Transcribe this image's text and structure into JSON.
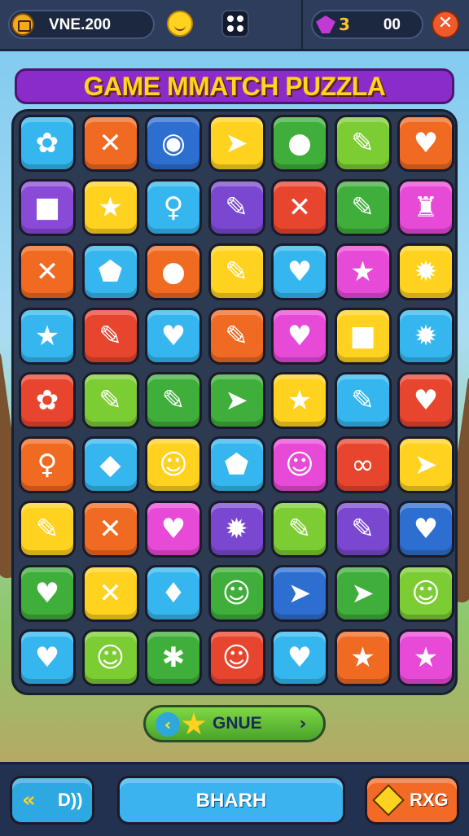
{
  "header": {
    "coin_value": "VNE.200",
    "gem_value": "00",
    "close_label": "✕",
    "gem_marker": "3"
  },
  "title": "GAME MMATCH PUZZLA",
  "board": {
    "colors": {
      "cyan": "#35b6ee",
      "orange": "#f06a22",
      "blue": "#2d6fd0",
      "yellow": "#ffd21f",
      "green": "#3fae3a",
      "lime": "#7ccc34",
      "red": "#e8452f",
      "purple": "#8a4ad8",
      "magenta": "#e84ad8",
      "violet": "#7a48d0"
    },
    "rows": [
      [
        [
          "cyan",
          "flower-icon",
          "✿"
        ],
        [
          "orange",
          "cross-icon",
          "✕"
        ],
        [
          "blue",
          "ring-icon",
          "◉"
        ],
        [
          "yellow",
          "arrow-icon",
          "➤"
        ],
        [
          "green",
          "ball-icon",
          "●"
        ],
        [
          "lime",
          "pencil-icon",
          "✎"
        ],
        [
          "orange",
          "heart-icon",
          "♥"
        ]
      ],
      [
        [
          "purple",
          "square-icon",
          "■"
        ],
        [
          "yellow",
          "star-icon",
          "★"
        ],
        [
          "cyan",
          "lollipop-icon",
          "♀"
        ],
        [
          "violet",
          "pencil-icon",
          "✎"
        ],
        [
          "red",
          "cross-icon",
          "✕"
        ],
        [
          "green",
          "pencil-icon",
          "✎"
        ],
        [
          "magenta",
          "cake-icon",
          "♜"
        ]
      ],
      [
        [
          "orange",
          "cross-icon",
          "✕"
        ],
        [
          "cyan",
          "gem-icon",
          "⬟"
        ],
        [
          "orange",
          "ball-icon",
          "●"
        ],
        [
          "yellow",
          "pencil-icon",
          "✎"
        ],
        [
          "cyan",
          "heart-icon",
          "♥"
        ],
        [
          "magenta",
          "star-icon",
          "★"
        ],
        [
          "yellow",
          "gear-icon",
          "✹"
        ]
      ],
      [
        [
          "cyan",
          "star-icon",
          "★"
        ],
        [
          "red",
          "pencil-icon",
          "✎"
        ],
        [
          "cyan",
          "heart-icon",
          "♥"
        ],
        [
          "orange",
          "pencil-icon",
          "✎"
        ],
        [
          "magenta",
          "heart-icon",
          "♥"
        ],
        [
          "yellow",
          "square-icon",
          "■"
        ],
        [
          "cyan",
          "gear-icon",
          "✹"
        ]
      ],
      [
        [
          "red",
          "flower-icon",
          "✿"
        ],
        [
          "lime",
          "pencil-icon",
          "✎"
        ],
        [
          "green",
          "pencil-icon",
          "✎"
        ],
        [
          "green",
          "arrow-icon",
          "➤"
        ],
        [
          "yellow",
          "star-icon",
          "★"
        ],
        [
          "cyan",
          "pencil-icon",
          "✎"
        ],
        [
          "red",
          "heart-icon",
          "♥"
        ]
      ],
      [
        [
          "orange",
          "pin-icon",
          "♀"
        ],
        [
          "cyan",
          "gem-icon",
          "◆"
        ],
        [
          "yellow",
          "smiley-icon",
          "☺"
        ],
        [
          "cyan",
          "gem-icon",
          "⬟"
        ],
        [
          "magenta",
          "smiley-icon",
          "☺"
        ],
        [
          "red",
          "knot-icon",
          "∞"
        ],
        [
          "yellow",
          "arrow-icon",
          "➤"
        ]
      ],
      [
        [
          "yellow",
          "pencil-icon",
          "✎"
        ],
        [
          "orange",
          "cross-icon",
          "✕"
        ],
        [
          "magenta",
          "heart-icon",
          "♥"
        ],
        [
          "violet",
          "gear-icon",
          "✹"
        ],
        [
          "lime",
          "pencil-icon",
          "✎"
        ],
        [
          "violet",
          "pencil-icon",
          "✎"
        ],
        [
          "blue",
          "heart-icon",
          "♥"
        ]
      ],
      [
        [
          "green",
          "heart-icon",
          "♥"
        ],
        [
          "yellow",
          "cross-icon",
          "✕"
        ],
        [
          "cyan",
          "drop-icon",
          "♦"
        ],
        [
          "green",
          "face-icon",
          "☺"
        ],
        [
          "blue",
          "arrow-icon",
          "➤"
        ],
        [
          "green",
          "arrow-icon",
          "➤"
        ],
        [
          "lime",
          "face-icon",
          "☺"
        ]
      ],
      [
        [
          "cyan",
          "heart-icon",
          "♥"
        ],
        [
          "lime",
          "face-icon",
          "☺"
        ],
        [
          "green",
          "bug-icon",
          "✱"
        ],
        [
          "red",
          "smiley-icon",
          "☺"
        ],
        [
          "cyan",
          "heart-icon",
          "♥"
        ],
        [
          "orange",
          "star-icon",
          "★"
        ],
        [
          "magenta",
          "star-icon",
          "★"
        ]
      ]
    ]
  },
  "nav": {
    "left": "‹",
    "label": "GNUE",
    "right": "›"
  },
  "bottom": {
    "left_label": "D))",
    "left_icon": "«",
    "center_label": "BHARH",
    "right_label": "RXG"
  }
}
